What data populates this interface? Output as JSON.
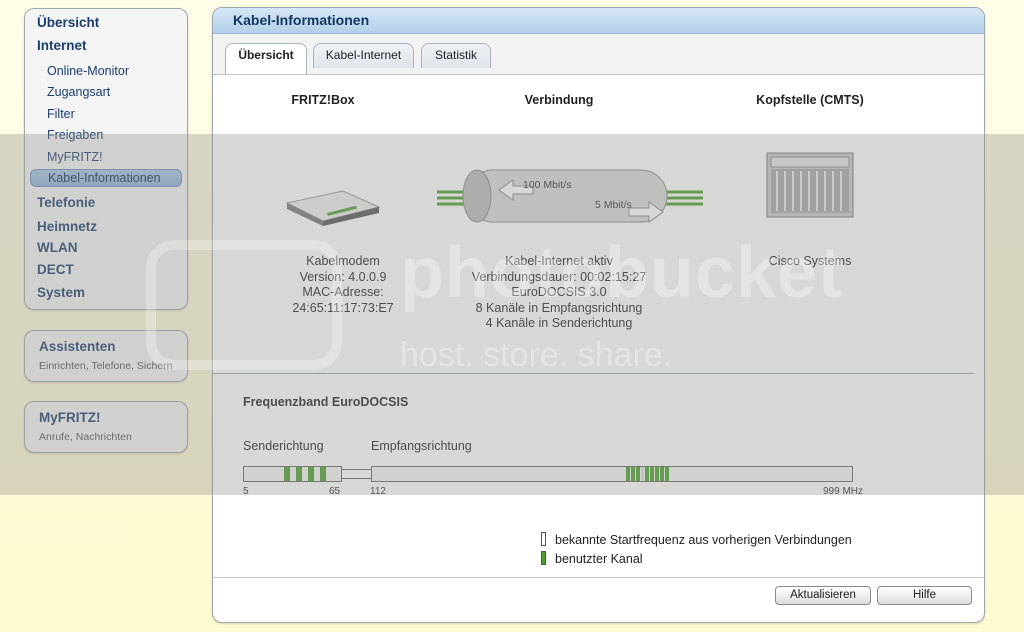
{
  "nav": {
    "main": [
      "Übersicht",
      "Internet",
      "Telefonie",
      "Heimnetz",
      "WLAN",
      "DECT",
      "System"
    ],
    "internet_sub": [
      "Online-Monitor",
      "Zugangsart",
      "Filter",
      "Freigaben",
      "MyFRITZ!"
    ],
    "active": "Kabel-Informationen"
  },
  "assist": {
    "title": "Assistenten",
    "sub": "Einrichten, Telefone, Sichern"
  },
  "myfritz": {
    "title": "MyFRITZ!",
    "sub": "Anrufe, Nachrichten"
  },
  "main": {
    "title": "Kabel-Informationen",
    "tabs": [
      "Übersicht",
      "Kabel-Internet",
      "Statistik"
    ],
    "col1": {
      "header": "FRITZ!Box",
      "lines": [
        "Kabelmodem",
        "Version: 4.0.0.9",
        "MAC-Adresse:",
        "24:65:11:17:73:E7"
      ]
    },
    "col2": {
      "header": "Verbindung",
      "down": "100 Mbit/s",
      "up": "5 Mbit/s",
      "lines": [
        "Kabel-Internet aktiv",
        "Verbindungsdauer: 00:02:15:27",
        "EuroDOCSIS 3.0",
        "8 Kanäle in Empfangsrichtung",
        "4 Kanäle in Senderichtung"
      ]
    },
    "col3": {
      "header": "Kopfstelle (CMTS)",
      "lines": [
        "Cisco Systems"
      ]
    },
    "freq": {
      "title": "Frequenzband EuroDOCSIS",
      "send_label": "Senderichtung",
      "recv_label": "Empfangsrichtung",
      "ticks": [
        "5",
        "65",
        "112",
        "999 MHz"
      ],
      "channel_color": "#4aa02c",
      "send_channels_count": 4,
      "recv_channels_count": 8
    },
    "legend": [
      "bekannte Startfrequenz aus vorherigen Verbindungen",
      "benutzter Kanal"
    ],
    "buttons": {
      "refresh": "Aktualisieren",
      "help": "Hilfe"
    }
  },
  "watermark": {
    "line1": "photobucket",
    "line2": "host. store. share."
  }
}
